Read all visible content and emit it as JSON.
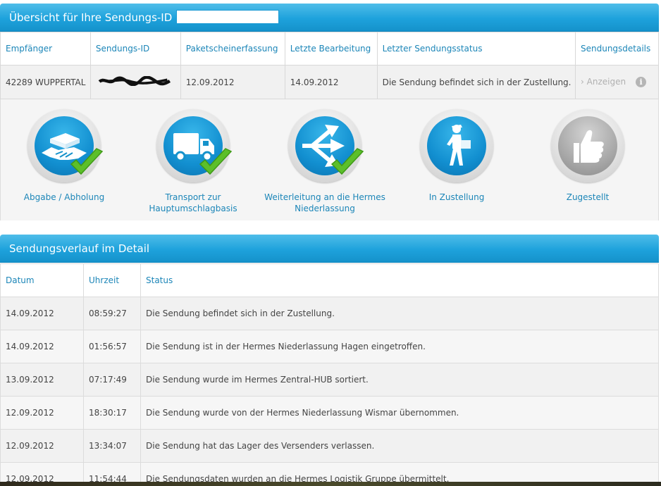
{
  "overview": {
    "title": "Übersicht für Ihre Sendungs-ID",
    "columns": [
      "Empfänger",
      "Sendungs-ID",
      "Paketscheinerfassung",
      "Letzte Bearbeitung",
      "Letzter Sendungsstatus",
      "Sendungsdetails"
    ],
    "row": {
      "recipient": "42289 WUPPERTAL",
      "registered": "12.09.2012",
      "last_processed": "14.09.2012",
      "last_status": "Die Sendung befindet sich in der Zustellung.",
      "details_link": "Anzeigen",
      "details_chevron": "›",
      "info_icon": "i"
    }
  },
  "steps": [
    {
      "label": "Abgabe / Abholung",
      "icon": "handshake-icon",
      "done": true
    },
    {
      "label": "Transport zur Hauptumschlagbasis",
      "icon": "truck-icon",
      "done": true
    },
    {
      "label": "Weiterleitung an die Hermes Niederlassung",
      "icon": "arrows-split-icon",
      "done": true
    },
    {
      "label": "In Zustellung",
      "icon": "courier-icon",
      "done": false
    },
    {
      "label": "Zugestellt",
      "icon": "thumbs-up-icon",
      "done": false
    }
  ],
  "history": {
    "title": "Sendungsverlauf im Detail",
    "columns": [
      "Datum",
      "Uhrzeit",
      "Status"
    ],
    "rows": [
      [
        "14.09.2012",
        "08:59:27",
        "Die Sendung befindet sich in der Zustellung."
      ],
      [
        "14.09.2012",
        "01:56:57",
        "Die Sendung ist in der Hermes Niederlassung Hagen eingetroffen."
      ],
      [
        "13.09.2012",
        "07:17:49",
        "Die Sendung wurde im Hermes Zentral-HUB sortiert."
      ],
      [
        "12.09.2012",
        "18:30:17",
        "Die Sendung wurde von der Hermes Niederlassung Wismar übernommen."
      ],
      [
        "12.09.2012",
        "13:34:07",
        "Die Sendung hat das Lager des Versenders verlassen."
      ],
      [
        "12.09.2012",
        "11:54:44",
        "Die Sendungsdaten wurden an die Hermes Logistik Gruppe übermittelt."
      ]
    ]
  },
  "colors": {
    "accent": "#1ea2dc",
    "link": "#1c86b8",
    "check": "#5cbf2a"
  }
}
